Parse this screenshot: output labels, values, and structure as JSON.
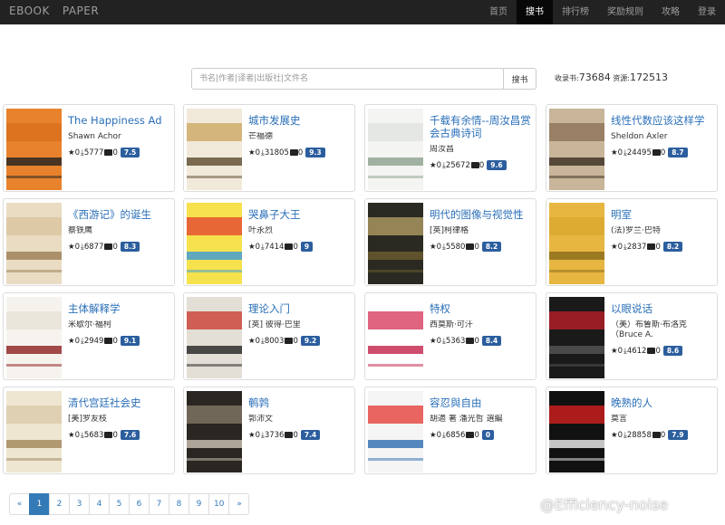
{
  "navbar": {
    "brand_a": "EBOOK",
    "brand_b": "PAPER",
    "items": [
      {
        "label": "首页",
        "active": false
      },
      {
        "label": "搜书",
        "active": true
      },
      {
        "label": "排行榜",
        "active": false
      },
      {
        "label": "奖励规则",
        "active": false
      },
      {
        "label": "攻略",
        "active": false
      },
      {
        "label": "登录",
        "active": false
      }
    ]
  },
  "search": {
    "placeholder": "书名|作者|译者|出版社|文件名",
    "button": "搜书"
  },
  "stats": {
    "books_label": "收录书:",
    "books_count": "73684",
    "resources_label": "资源:",
    "resources_count": "172513"
  },
  "books": [
    {
      "title": "The Happiness Ad",
      "author": "Shawn Achor",
      "likes": "0",
      "downloads": "5777",
      "comments": "0",
      "rating": "7.5",
      "cover": [
        "#e8822c",
        "#d96d1a",
        "#222"
      ]
    },
    {
      "title": "城市发展史",
      "author": "芒福德",
      "likes": "0",
      "downloads": "31805",
      "comments": "0",
      "rating": "9.3",
      "cover": [
        "#f1eadb",
        "#c9a45c",
        "#5b4a2e"
      ]
    },
    {
      "title": "千载有余情--周汝昌赏会古典诗词",
      "author": "周汝昌",
      "likes": "0",
      "downloads": "25672",
      "comments": "0",
      "rating": "9.6",
      "cover": [
        "#f4f4f2",
        "#dfe3df",
        "#8ca08c"
      ]
    },
    {
      "title": "线性代数应该这样学",
      "author": "Sheldon Axler",
      "likes": "0",
      "downloads": "24495",
      "comments": "0",
      "rating": "8.7",
      "cover": [
        "#c8b59a",
        "#8a6f52",
        "#3a2d20"
      ]
    },
    {
      "title": "《西游记》的诞生",
      "author": "蔡铁鹰",
      "likes": "0",
      "downloads": "6877",
      "comments": "0",
      "rating": "8.3",
      "cover": [
        "#e9dcc3",
        "#d8c39c",
        "#9a7d52"
      ]
    },
    {
      "title": "哭鼻子大王",
      "author": "叶永烈",
      "likes": "0",
      "downloads": "7414",
      "comments": "0",
      "rating": "9",
      "cover": [
        "#f5e24c",
        "#e33d2f",
        "#3a9ad9"
      ]
    },
    {
      "title": "明代的图像与视觉性",
      "author": "[英]柯律格",
      "likes": "0",
      "downloads": "5580",
      "comments": "0",
      "rating": "8.2",
      "cover": [
        "#2b2a22",
        "#b9a468",
        "#6d5d30"
      ]
    },
    {
      "title": "明室",
      "author": "(法)罗兰·巴特",
      "likes": "0",
      "downloads": "2837",
      "comments": "0",
      "rating": "8.2",
      "cover": [
        "#e6b640",
        "#d9a52e",
        "#8a6a1c"
      ]
    },
    {
      "title": "主体解释学",
      "author": "米歇尔·福柯",
      "likes": "0",
      "downloads": "2949",
      "comments": "0",
      "rating": "9.1",
      "cover": [
        "#f6f3ee",
        "#e7e1d6",
        "#8b1e1e"
      ]
    },
    {
      "title": "理论入门",
      "author": "[英] 彼得·巴里",
      "likes": "0",
      "downloads": "8003",
      "comments": "0",
      "rating": "9.2",
      "cover": [
        "#e3dfd6",
        "#c8342a",
        "#222"
      ]
    },
    {
      "title": "特权",
      "author": "西莫斯·可汗",
      "likes": "0",
      "downloads": "5363",
      "comments": "0",
      "rating": "8.4",
      "cover": [
        "#ffffff",
        "#d62f56",
        "#c22048"
      ]
    },
    {
      "title": "以眼说话",
      "author": "（美）布鲁斯·布洛克（Bruce A.",
      "likes": "0",
      "downloads": "4612",
      "comments": "0",
      "rating": "8.6",
      "cover": [
        "#1a1a1a",
        "#c41f2a",
        "#555"
      ]
    },
    {
      "title": "清代宫廷社会史",
      "author": "[美]罗友枝",
      "likes": "0",
      "downloads": "5683",
      "comments": "0",
      "rating": "7.6",
      "cover": [
        "#efe6d2",
        "#d9c8a5",
        "#a0865a"
      ]
    },
    {
      "title": "鹌鹑",
      "author": "郭沛文",
      "likes": "0",
      "downloads": "3736",
      "comments": "0",
      "rating": "7.4",
      "cover": [
        "#2a2622",
        "#8a7d6c",
        "#cfc6b8"
      ]
    },
    {
      "title": "容忍與自由",
      "author": "胡適 著 潘光哲 選編",
      "likes": "0",
      "downloads": "6856",
      "comments": "0",
      "rating": "0",
      "cover": [
        "#f5f5f5",
        "#e3342f",
        "#2b6cb0"
      ]
    },
    {
      "title": "晚熟的人",
      "author": "莫言",
      "likes": "0",
      "downloads": "28858",
      "comments": "0",
      "rating": "7.9",
      "cover": [
        "#111111",
        "#e0201f",
        "#f2f2f2"
      ]
    }
  ],
  "pagination": {
    "prev": "«",
    "pages": [
      "1",
      "2",
      "3",
      "4",
      "5",
      "6",
      "7",
      "8",
      "9",
      "10"
    ],
    "active": "1",
    "next": "»"
  },
  "watermark": "@Efficiency-noise",
  "icons": {
    "like": "star-icon",
    "download": "download-icon",
    "comment": "comment-icon"
  }
}
